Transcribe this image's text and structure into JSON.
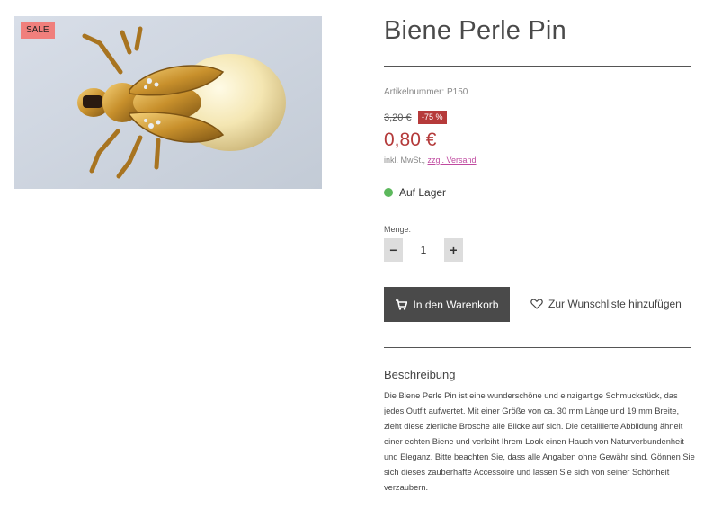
{
  "product": {
    "badge": "SALE",
    "title": "Biene Perle Pin",
    "sku": "Artikelnummer: P150",
    "old_price": "3,20 €",
    "discount": "-75 %",
    "price": "0,80 €",
    "tax_text": "inkl. MwSt., ",
    "shipping_link": "zzgl. Versand",
    "stock_label": "Auf Lager",
    "stock_color": "#5cb85c"
  },
  "quantity": {
    "label": "Menge:",
    "minus": "−",
    "value": "1",
    "plus": "+"
  },
  "actions": {
    "cart_label": "In den Warenkorb",
    "cart_icon": "shopping-cart-icon",
    "wishlist_label": "Zur Wunschliste hinzufügen",
    "wishlist_icon": "heart-icon"
  },
  "description": {
    "heading": "Beschreibung",
    "text": "Die Biene Perle Pin ist eine wunderschöne und einzigartige Schmuckstück, das jedes Outfit aufwertet. Mit einer Größe von ca. 30 mm Länge und 19 mm Breite, zieht diese zierliche Brosche alle Blicke auf sich. Die detaillierte Abbildung ähnelt einer echten Biene und verleiht Ihrem Look einen Hauch von Naturverbundenheit und Eleganz. Bitte beachten Sie, dass alle Angaben ohne Gewähr sind. Gönnen Sie sich dieses zauberhafte Accessoire und lassen Sie sich von seiner Schönheit verzaubern."
  },
  "colors": {
    "price": "#b43a3a",
    "badge": "#f07f7c",
    "discount": "#b63a3a",
    "button": "#4a4a4a",
    "link": "#c04aa0"
  }
}
